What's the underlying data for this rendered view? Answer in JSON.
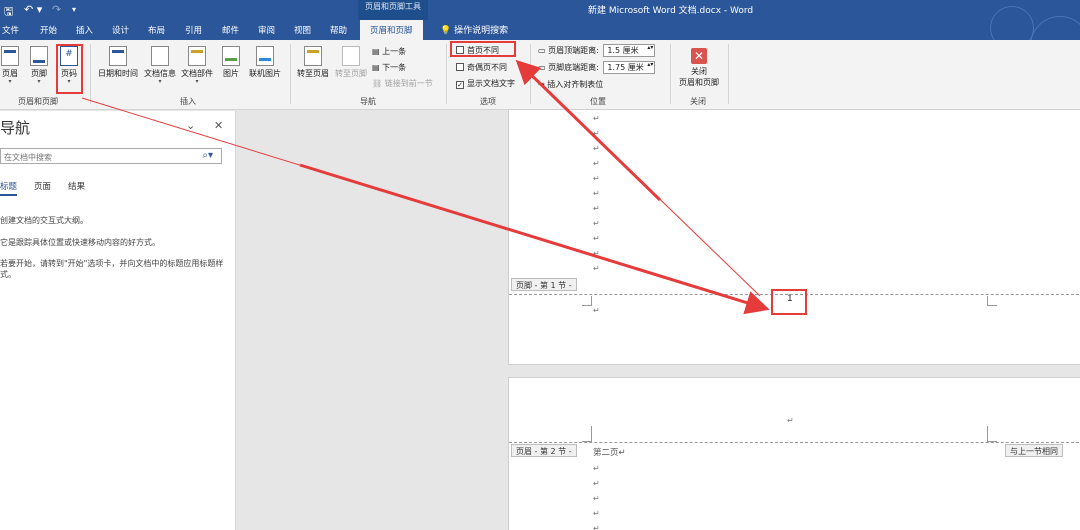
{
  "titlebar": {
    "contextual_tools": "页眉和页脚工具",
    "doc_title": "新建 Microsoft Word 文档.docx  -  Word",
    "qa_save": "🖫",
    "qa_undo": "↶ ▾",
    "qa_redo": "↷",
    "qa_more": "▾"
  },
  "tabs": {
    "file": "文件",
    "home": "开始",
    "insert": "插入",
    "design": "设计",
    "layout": "布局",
    "references": "引用",
    "mailings": "邮件",
    "review": "审阅",
    "view": "视图",
    "help": "帮助",
    "header_footer": "页眉和页脚",
    "tell_me_icon": "💡",
    "tell_me": "操作说明搜索"
  },
  "ribbon": {
    "hf_group": {
      "label": "页眉和页脚",
      "header": "页眉",
      "footer": "页脚",
      "page_number": "页码",
      "page_number_icon_text": "#"
    },
    "insert_group": {
      "label": "插入",
      "date_time": "日期和时间",
      "doc_info": "文档信息",
      "quick_parts": "文档部件",
      "picture": "图片",
      "online_picture": "联机图片"
    },
    "nav_group": {
      "label": "导航",
      "goto_header": "转至页眉",
      "goto_footer": "转至页脚",
      "previous": "上一条",
      "next": "下一条",
      "link_previous": "链接到前一节"
    },
    "options_group": {
      "label": "选项",
      "different_first": "首页不同",
      "different_odd_even": "奇偶页不同",
      "show_doc_text": "显示文档文字",
      "checkmark": "✓"
    },
    "position_group": {
      "label": "位置",
      "header_top_label": "页眉顶端距离:",
      "header_top_value": "1.5 厘米",
      "footer_bottom_label": "页脚底端距离:",
      "footer_bottom_value": "1.75 厘米",
      "insert_align_tab": "插入对齐制表位"
    },
    "close_group": {
      "label": "关闭",
      "close_line1": "关闭",
      "close_line2": "页眉和页脚",
      "close_icon": "✕"
    },
    "caret": "▾"
  },
  "nav_pane": {
    "title": "导航",
    "collapse_icon": "⌄",
    "close_icon": "✕",
    "search_placeholder": "在文档中搜索",
    "search_icon": "⌕▾",
    "tabs": [
      "标题",
      "页面",
      "结果"
    ],
    "help_line1": "创建文档的交互式大纲。",
    "help_line2": "它是跟踪具体位置或快速移动内容的好方式。",
    "help_line3": "若要开始，请转到\"开始\"选项卡，并向文档中的标题应用标题样式。"
  },
  "document": {
    "para_mark": "↵",
    "footer_tag_1": "页脚 - 第 1 节 -",
    "page_number_value": "1",
    "header_tag_2": "页眉 - 第 2 节 -",
    "page2_text": "第二页",
    "same_as_previous": "与上一节相同"
  },
  "colors": {
    "title_blue": "#2b579a",
    "annotation_red": "#e63b3b"
  }
}
